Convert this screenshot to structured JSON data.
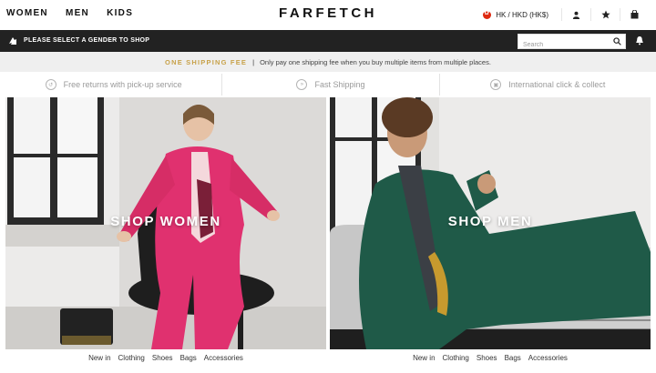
{
  "header": {
    "nav": [
      "WOMEN",
      "MEN",
      "KIDS"
    ],
    "logo": "FARFETCH",
    "region": "HK / HKD (HK$)",
    "icons": [
      "account-icon",
      "wishlist-star-icon",
      "shopping-bag-icon"
    ]
  },
  "gender_bar": {
    "text": "PLEASE SELECT A GENDER TO SHOP",
    "search_placeholder": "Search",
    "icons": [
      "gender-arrow-icon",
      "search-icon",
      "notification-bell-icon"
    ]
  },
  "promo": {
    "title": "ONE SHIPPING FEE",
    "separator": "|",
    "body": "Only pay one shipping fee when you buy multiple items from multiple places."
  },
  "features": [
    {
      "label": "Free returns with pick-up service",
      "icon": "returns-icon"
    },
    {
      "label": "Fast Shipping",
      "icon": "shipping-icon"
    },
    {
      "label": "International click & collect",
      "icon": "collect-icon"
    }
  ],
  "women": {
    "title": "SHOP WOMEN",
    "categories": [
      "New in",
      "Clothing",
      "Shoes",
      "Bags",
      "Accessories"
    ]
  },
  "men": {
    "title": "SHOP MEN",
    "categories": [
      "New in",
      "Clothing",
      "Shoes",
      "Bags",
      "Accessories"
    ]
  },
  "colors": {
    "brand_dark": "#222222",
    "promo_accent": "#c8a24a",
    "promo_background": "#efefef",
    "women_suit": "#e0316f",
    "men_suit": "#1f5a48"
  }
}
